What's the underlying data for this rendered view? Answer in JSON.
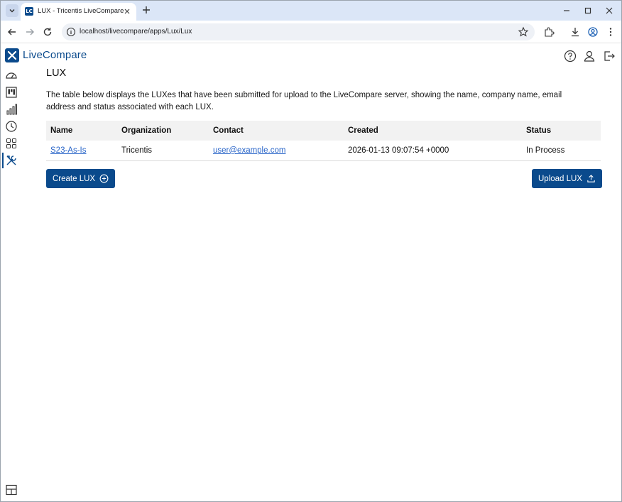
{
  "browser": {
    "tab_title": "LUX - Tricentis LiveCompare",
    "favicon_text": "LC",
    "url": "localhost/livecompare/apps/Lux/Lux"
  },
  "app": {
    "logo_text": "LiveCompare",
    "brand_color": "#0a4a8c",
    "header_icons": [
      "help-icon",
      "user-icon",
      "logout-icon"
    ],
    "sidebar_icons": [
      "dashboard-icon",
      "kanban-icon",
      "bar-chart-icon",
      "history-clock-icon",
      "apps-grid-icon",
      "tools-icon",
      "layout-toggle-icon"
    ]
  },
  "page": {
    "title": "LUX",
    "description": "The table below displays the LUXes that have been submitted for upload to the LiveCompare server, showing the name, company name, email address and status associated with each LUX."
  },
  "table": {
    "headers": {
      "name": "Name",
      "organization": "Organization",
      "contact": "Contact",
      "created": "Created",
      "status": "Status"
    },
    "rows": [
      {
        "name": "S23-As-Is",
        "organization": "Tricentis",
        "contact": "user@example.com",
        "created": "2026-01-13 09:07:54 +0000",
        "status": "In Process"
      }
    ]
  },
  "actions": {
    "create_label": "Create LUX",
    "upload_label": "Upload LUX"
  }
}
